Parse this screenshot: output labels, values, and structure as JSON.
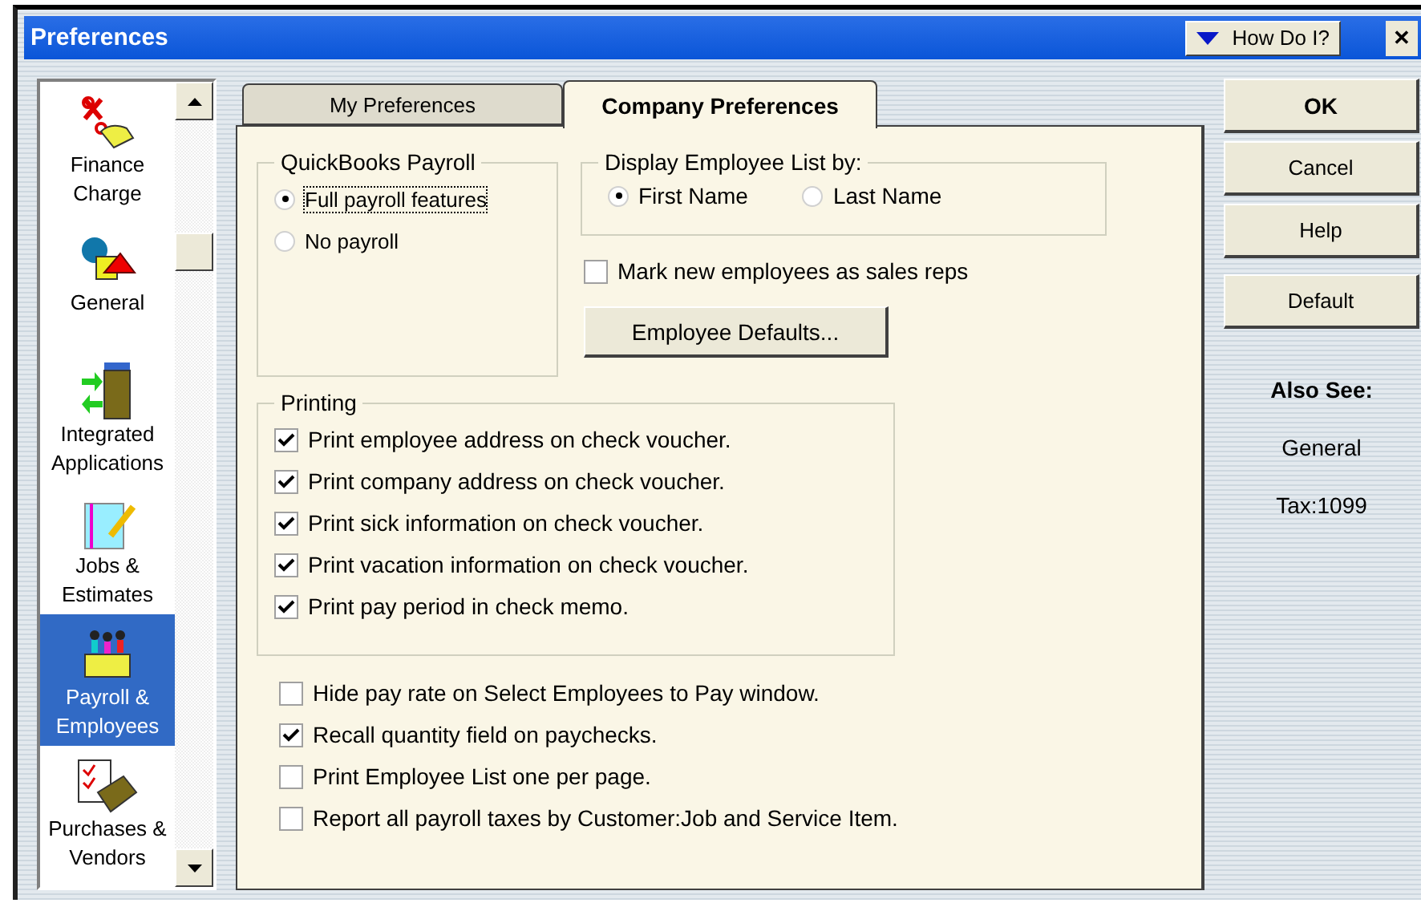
{
  "window": {
    "title": "Preferences",
    "help_button": "How Do I?",
    "close_button": "✕"
  },
  "sidebar": {
    "items": [
      {
        "label": "Finance Charge",
        "selected": false
      },
      {
        "label": "General",
        "selected": false
      },
      {
        "label": "Integrated Applications",
        "selected": false
      },
      {
        "label": "Jobs & Estimates",
        "selected": false
      },
      {
        "label": "Payroll & Employees",
        "selected": true
      },
      {
        "label": "Purchases & Vendors",
        "selected": false
      }
    ]
  },
  "tabs": [
    {
      "label": "My Preferences",
      "selected": false
    },
    {
      "label": "Company Preferences",
      "selected": true
    }
  ],
  "payroll_group": {
    "title": "QuickBooks Payroll",
    "options": [
      {
        "label": "Full payroll features",
        "selected": true
      },
      {
        "label": "No payroll",
        "selected": false
      }
    ]
  },
  "display_group": {
    "title": "Display Employee List by:",
    "options": [
      {
        "label": "First Name",
        "selected": true
      },
      {
        "label": "Last Name",
        "selected": false
      }
    ]
  },
  "sales_rep_option": {
    "label": "Mark new employees as sales reps",
    "checked": false
  },
  "employee_defaults_button": "Employee Defaults...",
  "printing_group": {
    "title": "Printing",
    "items": [
      {
        "label": "Print employee address on check voucher.",
        "checked": true
      },
      {
        "label": "Print company address on check voucher.",
        "checked": true
      },
      {
        "label": "Print sick information on check voucher.",
        "checked": true
      },
      {
        "label": "Print vacation information on check voucher.",
        "checked": true
      },
      {
        "label": "Print pay period in check memo.",
        "checked": true
      }
    ]
  },
  "options": [
    {
      "label": "Hide pay rate on Select Employees to Pay window.",
      "checked": false
    },
    {
      "label": "Recall quantity field on paychecks.",
      "checked": true
    },
    {
      "label": "Print Employee List one per page.",
      "checked": false
    },
    {
      "label": "Report all payroll taxes by Customer:Job and Service Item.",
      "checked": false
    }
  ],
  "buttons": [
    {
      "label": "OK",
      "kind": "primary"
    },
    {
      "label": "Cancel",
      "kind": "normal"
    },
    {
      "label": "Help",
      "kind": "normal"
    },
    {
      "label": "Default",
      "kind": "separated"
    }
  ],
  "also_see": {
    "title": "Also See:",
    "links": [
      "General",
      "Tax:1099"
    ]
  }
}
